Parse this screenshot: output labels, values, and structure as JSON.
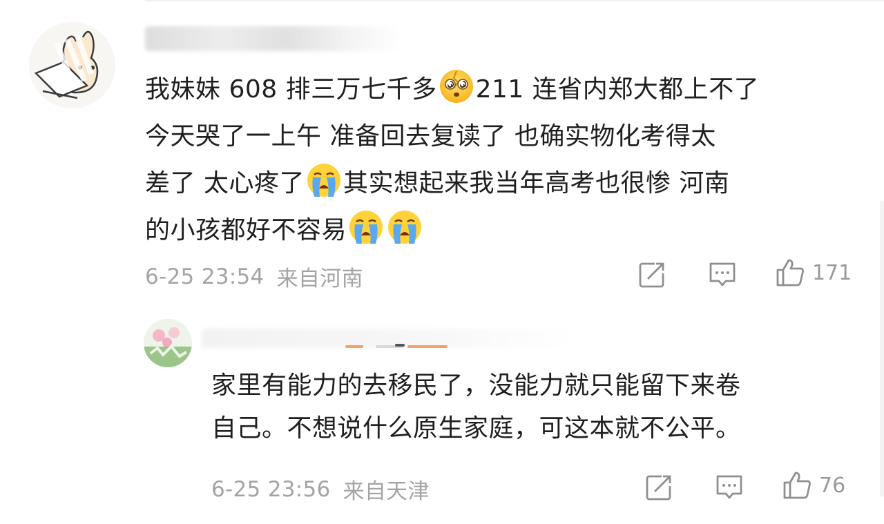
{
  "comment": {
    "text_lines": [
      "我妹妹 608 排三万七千多",
      "211 连省内郑大都上不了",
      "今天哭了一上午 准备回去复读了 也确实物化考得太",
      "差了 太心疼了",
      "其实想起来我当年高考也很惨 河南",
      "的小孩都好不容易"
    ],
    "time": "6-25 23:54",
    "location": "来自河南",
    "like_count": "171"
  },
  "reply": {
    "text_lines": [
      "家里有能力的去移民了，没能力就只能留下来卷",
      "自己。不想说什么原生家庭，可这本就不公平。"
    ],
    "time": "6-25 23:56",
    "location": "来自天津",
    "like_count": "76"
  },
  "icons": {
    "emoji_1": "dizzy-face-emoji",
    "emoji_2": "loudly-crying-face-emoji",
    "share": "share-icon",
    "reply": "comment-icon",
    "like": "thumbs-up-icon"
  },
  "colors": {
    "text": "#1f1f1f",
    "meta": "#a4a4a4",
    "emoji_yellow": "#ffd23a",
    "tears": "#5aa9f0"
  }
}
